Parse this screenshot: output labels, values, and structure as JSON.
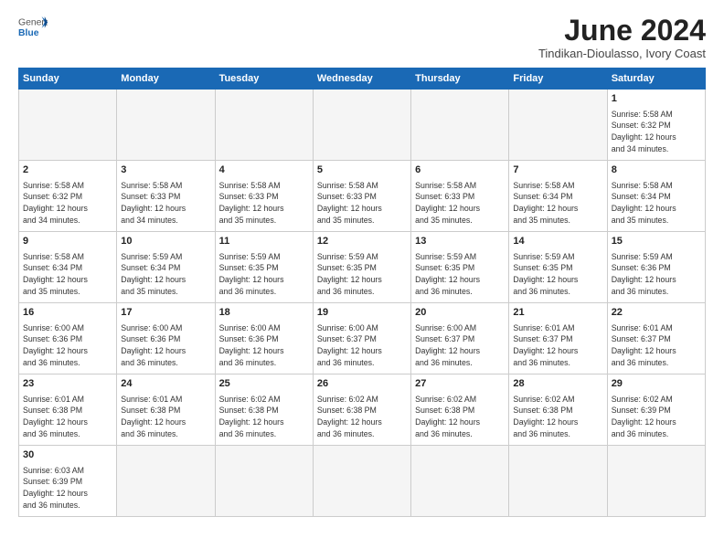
{
  "header": {
    "logo_general": "General",
    "logo_blue": "Blue",
    "title": "June 2024",
    "subtitle": "Tindikan-Dioulasso, Ivory Coast"
  },
  "days_of_week": [
    "Sunday",
    "Monday",
    "Tuesday",
    "Wednesday",
    "Thursday",
    "Friday",
    "Saturday"
  ],
  "weeks": [
    [
      {
        "day": "",
        "info": "",
        "empty": true
      },
      {
        "day": "",
        "info": "",
        "empty": true
      },
      {
        "day": "",
        "info": "",
        "empty": true
      },
      {
        "day": "",
        "info": "",
        "empty": true
      },
      {
        "day": "",
        "info": "",
        "empty": true
      },
      {
        "day": "",
        "info": "",
        "empty": true
      },
      {
        "day": "1",
        "info": "Sunrise: 5:58 AM\nSunset: 6:32 PM\nDaylight: 12 hours\nand 34 minutes."
      }
    ],
    [
      {
        "day": "2",
        "info": "Sunrise: 5:58 AM\nSunset: 6:32 PM\nDaylight: 12 hours\nand 34 minutes."
      },
      {
        "day": "3",
        "info": "Sunrise: 5:58 AM\nSunset: 6:33 PM\nDaylight: 12 hours\nand 34 minutes."
      },
      {
        "day": "4",
        "info": "Sunrise: 5:58 AM\nSunset: 6:33 PM\nDaylight: 12 hours\nand 35 minutes."
      },
      {
        "day": "5",
        "info": "Sunrise: 5:58 AM\nSunset: 6:33 PM\nDaylight: 12 hours\nand 35 minutes."
      },
      {
        "day": "6",
        "info": "Sunrise: 5:58 AM\nSunset: 6:33 PM\nDaylight: 12 hours\nand 35 minutes."
      },
      {
        "day": "7",
        "info": "Sunrise: 5:58 AM\nSunset: 6:34 PM\nDaylight: 12 hours\nand 35 minutes."
      },
      {
        "day": "8",
        "info": "Sunrise: 5:58 AM\nSunset: 6:34 PM\nDaylight: 12 hours\nand 35 minutes."
      }
    ],
    [
      {
        "day": "9",
        "info": "Sunrise: 5:58 AM\nSunset: 6:34 PM\nDaylight: 12 hours\nand 35 minutes."
      },
      {
        "day": "10",
        "info": "Sunrise: 5:59 AM\nSunset: 6:34 PM\nDaylight: 12 hours\nand 35 minutes."
      },
      {
        "day": "11",
        "info": "Sunrise: 5:59 AM\nSunset: 6:35 PM\nDaylight: 12 hours\nand 36 minutes."
      },
      {
        "day": "12",
        "info": "Sunrise: 5:59 AM\nSunset: 6:35 PM\nDaylight: 12 hours\nand 36 minutes."
      },
      {
        "day": "13",
        "info": "Sunrise: 5:59 AM\nSunset: 6:35 PM\nDaylight: 12 hours\nand 36 minutes."
      },
      {
        "day": "14",
        "info": "Sunrise: 5:59 AM\nSunset: 6:35 PM\nDaylight: 12 hours\nand 36 minutes."
      },
      {
        "day": "15",
        "info": "Sunrise: 5:59 AM\nSunset: 6:36 PM\nDaylight: 12 hours\nand 36 minutes."
      }
    ],
    [
      {
        "day": "16",
        "info": "Sunrise: 6:00 AM\nSunset: 6:36 PM\nDaylight: 12 hours\nand 36 minutes."
      },
      {
        "day": "17",
        "info": "Sunrise: 6:00 AM\nSunset: 6:36 PM\nDaylight: 12 hours\nand 36 minutes."
      },
      {
        "day": "18",
        "info": "Sunrise: 6:00 AM\nSunset: 6:36 PM\nDaylight: 12 hours\nand 36 minutes."
      },
      {
        "day": "19",
        "info": "Sunrise: 6:00 AM\nSunset: 6:37 PM\nDaylight: 12 hours\nand 36 minutes."
      },
      {
        "day": "20",
        "info": "Sunrise: 6:00 AM\nSunset: 6:37 PM\nDaylight: 12 hours\nand 36 minutes."
      },
      {
        "day": "21",
        "info": "Sunrise: 6:01 AM\nSunset: 6:37 PM\nDaylight: 12 hours\nand 36 minutes."
      },
      {
        "day": "22",
        "info": "Sunrise: 6:01 AM\nSunset: 6:37 PM\nDaylight: 12 hours\nand 36 minutes."
      }
    ],
    [
      {
        "day": "23",
        "info": "Sunrise: 6:01 AM\nSunset: 6:38 PM\nDaylight: 12 hours\nand 36 minutes."
      },
      {
        "day": "24",
        "info": "Sunrise: 6:01 AM\nSunset: 6:38 PM\nDaylight: 12 hours\nand 36 minutes."
      },
      {
        "day": "25",
        "info": "Sunrise: 6:02 AM\nSunset: 6:38 PM\nDaylight: 12 hours\nand 36 minutes."
      },
      {
        "day": "26",
        "info": "Sunrise: 6:02 AM\nSunset: 6:38 PM\nDaylight: 12 hours\nand 36 minutes."
      },
      {
        "day": "27",
        "info": "Sunrise: 6:02 AM\nSunset: 6:38 PM\nDaylight: 12 hours\nand 36 minutes."
      },
      {
        "day": "28",
        "info": "Sunrise: 6:02 AM\nSunset: 6:38 PM\nDaylight: 12 hours\nand 36 minutes."
      },
      {
        "day": "29",
        "info": "Sunrise: 6:02 AM\nSunset: 6:39 PM\nDaylight: 12 hours\nand 36 minutes."
      }
    ],
    [
      {
        "day": "30",
        "info": "Sunrise: 6:03 AM\nSunset: 6:39 PM\nDaylight: 12 hours\nand 36 minutes."
      },
      {
        "day": "",
        "info": "",
        "empty": true
      },
      {
        "day": "",
        "info": "",
        "empty": true
      },
      {
        "day": "",
        "info": "",
        "empty": true
      },
      {
        "day": "",
        "info": "",
        "empty": true
      },
      {
        "day": "",
        "info": "",
        "empty": true
      },
      {
        "day": "",
        "info": "",
        "empty": true
      }
    ]
  ]
}
